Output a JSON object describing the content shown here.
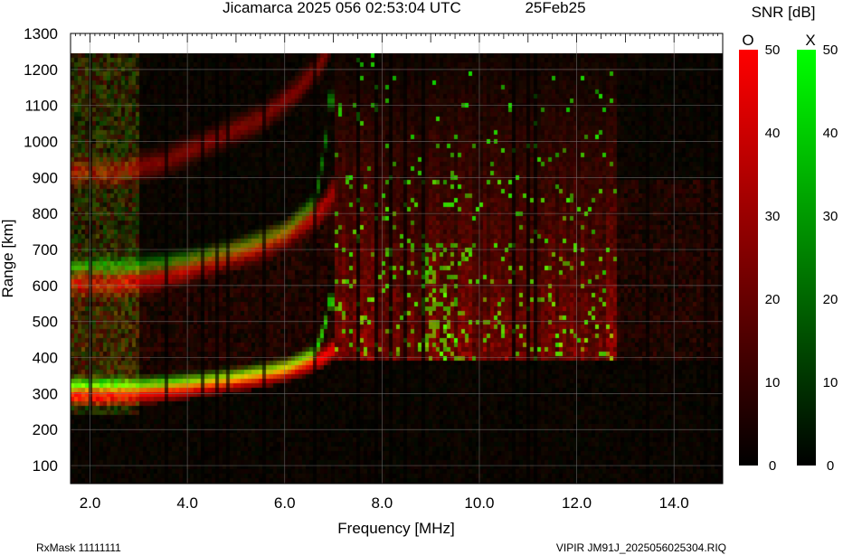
{
  "chart_data": {
    "type": "heatmap",
    "title": "Jicamarca 2025 056 02:53:04 UTC",
    "date": "25Feb25",
    "xlabel": "Frequency [MHz]",
    "ylabel": "Range [km]",
    "xlim": [
      1.6,
      15.0
    ],
    "ylim": [
      50,
      1300
    ],
    "data_ylim_top": 1245,
    "xticks": [
      2.0,
      4.0,
      6.0,
      8.0,
      10.0,
      12.0,
      14.0
    ],
    "xtick_labels": [
      "2.0",
      "4.0",
      "6.0",
      "8.0",
      "10.0",
      "12.0",
      "14.0"
    ],
    "yticks": [
      100,
      200,
      300,
      400,
      500,
      600,
      700,
      800,
      900,
      1000,
      1100,
      1200,
      1300
    ],
    "ytick_labels": [
      "100",
      "200",
      "300",
      "400",
      "500",
      "600",
      "700",
      "800",
      "900",
      "1000",
      "1100",
      "1200",
      "1300"
    ],
    "grid": true,
    "colorbar": {
      "title": "SNR [dB]",
      "range": [
        0,
        50
      ],
      "ticks": [
        0,
        10,
        20,
        30,
        40,
        50
      ],
      "tick_labels": [
        "0",
        "10",
        "20",
        "30",
        "40",
        "50"
      ],
      "channels": [
        {
          "name": "O",
          "color_low": "#000000",
          "color_high": "#ff0000"
        },
        {
          "name": "X",
          "color_low": "#000000",
          "color_high": "#00ff00"
        }
      ]
    },
    "series": [
      {
        "name": "O",
        "color": "#ff0000",
        "trace_points": [
          [
            1.7,
            300
          ],
          [
            2.5,
            300
          ],
          [
            3.5,
            310
          ],
          [
            4.5,
            330
          ],
          [
            5.5,
            350
          ],
          [
            6.2,
            375
          ],
          [
            6.7,
            400
          ],
          [
            7.0,
            430
          ]
        ]
      },
      {
        "name": "X",
        "color": "#00ff00",
        "trace_points": [
          [
            2.0,
            330
          ],
          [
            3.0,
            330
          ],
          [
            4.0,
            340
          ],
          [
            5.0,
            355
          ],
          [
            6.0,
            380
          ],
          [
            6.6,
            420
          ],
          [
            6.8,
            500
          ],
          [
            6.85,
            560
          ]
        ]
      }
    ]
  },
  "footer": {
    "left": "RxMask 11111111",
    "right": "VIPIR  JM91J_2025056025304.RIQ"
  }
}
